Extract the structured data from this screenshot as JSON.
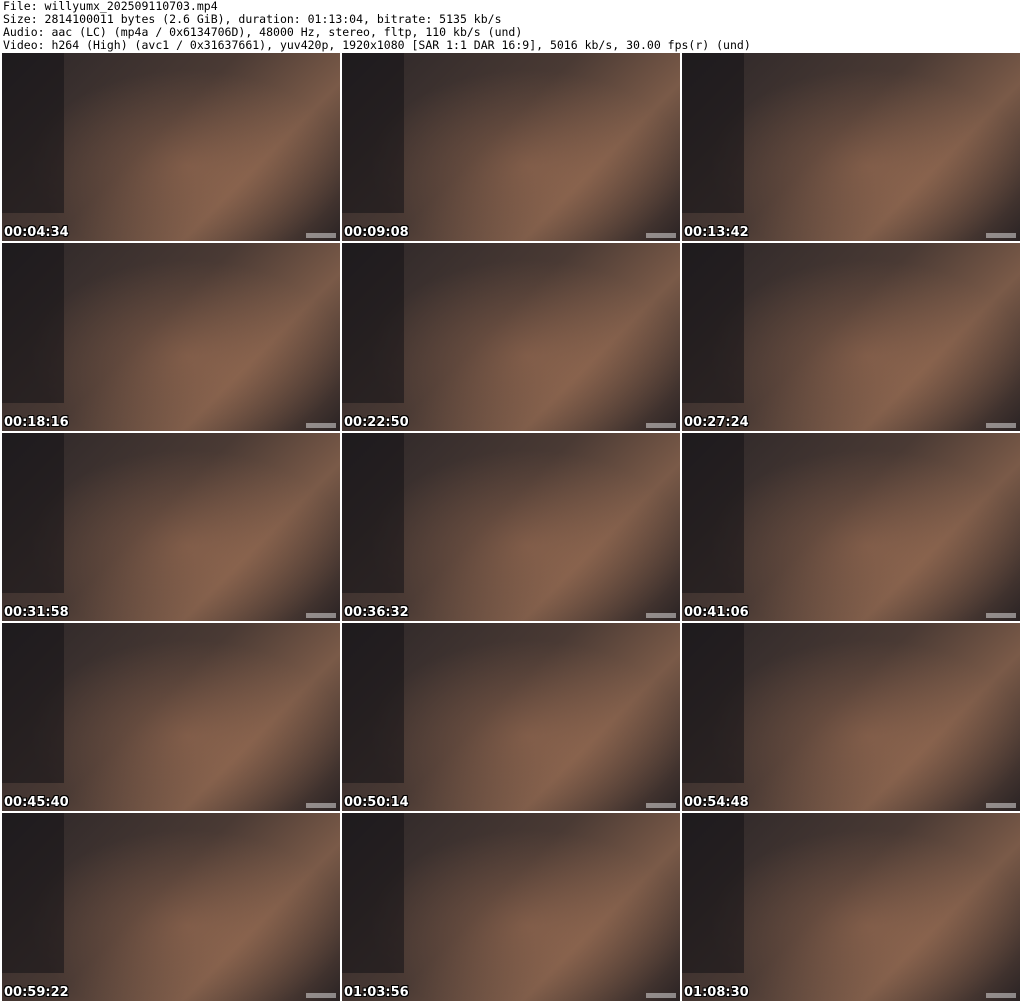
{
  "header": {
    "file": "File: willyumx_202509110703.mp4",
    "size": "Size: 2814100011 bytes (2.6 GiB), duration: 01:13:04, bitrate: 5135 kb/s",
    "audio": "Audio: aac (LC) (mp4a / 0x6134706D), 48000 Hz, stereo, fltp, 110 kb/s (und)",
    "video": "Video: h264 (High) (avc1 / 0x31637661), yuv420p, 1920x1080 [SAR 1:1 DAR 16:9], 5016 kb/s, 30.00 fps(r) (und)"
  },
  "thumbnails": [
    {
      "timestamp": "00:04:34"
    },
    {
      "timestamp": "00:09:08"
    },
    {
      "timestamp": "00:13:42"
    },
    {
      "timestamp": "00:18:16"
    },
    {
      "timestamp": "00:22:50"
    },
    {
      "timestamp": "00:27:24"
    },
    {
      "timestamp": "00:31:58"
    },
    {
      "timestamp": "00:36:32"
    },
    {
      "timestamp": "00:41:06"
    },
    {
      "timestamp": "00:45:40"
    },
    {
      "timestamp": "00:50:14"
    },
    {
      "timestamp": "00:54:48"
    },
    {
      "timestamp": "00:59:22"
    },
    {
      "timestamp": "01:03:56"
    },
    {
      "timestamp": "01:08:30"
    }
  ]
}
